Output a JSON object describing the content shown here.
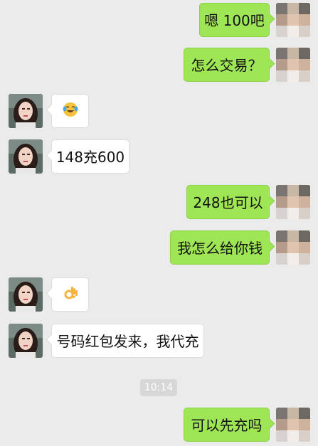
{
  "messages": [
    {
      "side": "out",
      "text": "嗯 100吧"
    },
    {
      "side": "out",
      "text": "怎么交易？"
    },
    {
      "side": "in",
      "emoji": "tears-of-joy-emoji"
    },
    {
      "side": "in",
      "text": "148充600"
    },
    {
      "side": "out",
      "text": "248也可以"
    },
    {
      "side": "out",
      "text": "我怎么给你钱"
    },
    {
      "side": "in",
      "emoji": "ok-hand-emoji"
    },
    {
      "side": "in",
      "text": "号码红包发来，我代充"
    },
    {
      "side": "out",
      "text": "可以先充吗"
    }
  ],
  "timestamp": "10:14",
  "colors": {
    "background": "#ebebeb",
    "sent_bubble": "#9fe657",
    "received_bubble": "#ffffff",
    "timestamp_bg": "#d7d7d7"
  },
  "icons": {
    "contact_avatar": "contact-avatar-icon",
    "self_avatar": "self-avatar-pixelated-icon"
  }
}
